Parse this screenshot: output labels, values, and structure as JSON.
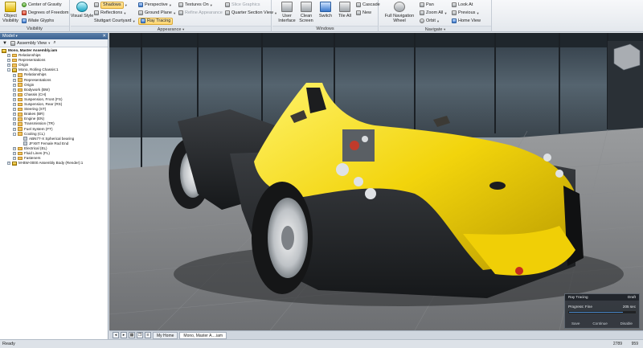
{
  "ribbon": {
    "visibility": {
      "label": "Visibility",
      "object_visibility": "Object\nVisibility",
      "center_of_gravity": "Center of Gravity",
      "degrees_of_freedom": "Degrees of Freedom",
      "imate_glyphs": "iMate Glyphs"
    },
    "appearance": {
      "label": "Appearance",
      "visual_style": "Visual Style",
      "shadows": "Shadows",
      "reflections": "Reflections",
      "stuttgart_courtyard": "Stuttgart Courtyard",
      "perspective": "Perspective",
      "ground_plane": "Ground Plane",
      "ray_tracing": "Ray Tracing",
      "textures_on": "Textures On",
      "refine_appearance": "Refine Appearance",
      "slice_graphics": "Slice Graphics",
      "quarter_section_view": "Quarter Section View"
    },
    "windows": {
      "label": "Windows",
      "user_interface": "User\nInterface",
      "clean_screen": "Clean\nScreen",
      "switch": "Switch",
      "tile_all": "Tile All",
      "cascade": "Cascade",
      "new": "New"
    },
    "navigate": {
      "label": "Navigate",
      "full_navigation_wheel": "Full Navigation\nWheel",
      "pan": "Pan",
      "zoom_all": "Zoom All",
      "orbit": "Orbit",
      "look_at": "Look At",
      "previous": "Previous",
      "home_view": "Home View"
    }
  },
  "browser": {
    "title": "Model",
    "filter_view": "Assembly View",
    "tree": [
      {
        "label": "Mono, Master Assembly.iam",
        "icon": "asm",
        "indent": 0,
        "bold": true
      },
      {
        "label": "Relationships",
        "icon": "fol",
        "indent": 1,
        "pm": "+"
      },
      {
        "label": "Representations",
        "icon": "fol",
        "indent": 1,
        "pm": "+"
      },
      {
        "label": "Origin",
        "icon": "fol",
        "indent": 1,
        "pm": "+"
      },
      {
        "label": "Mono, Rolling Chassis:1",
        "icon": "asm",
        "indent": 1,
        "pm": "-"
      },
      {
        "label": "Relationships",
        "icon": "fol",
        "indent": 2,
        "pm": "+"
      },
      {
        "label": "Representations",
        "icon": "fol",
        "indent": 2,
        "pm": "+"
      },
      {
        "label": "Origin",
        "icon": "fol",
        "indent": 2,
        "pm": "+"
      },
      {
        "label": "Bodywork (BW)",
        "icon": "fol",
        "indent": 2,
        "pm": "+"
      },
      {
        "label": "Chassis (CH)",
        "icon": "fol",
        "indent": 2,
        "pm": "+"
      },
      {
        "label": "Suspension, Front (FS)",
        "icon": "fol",
        "indent": 2,
        "pm": "+"
      },
      {
        "label": "Suspension, Rear (RS)",
        "icon": "fol",
        "indent": 2,
        "pm": "+"
      },
      {
        "label": "Steering (ST)",
        "icon": "fol",
        "indent": 2,
        "pm": "+"
      },
      {
        "label": "Brakes (BR)",
        "icon": "fol",
        "indent": 2,
        "pm": "+"
      },
      {
        "label": "Engine (EN)",
        "icon": "fol",
        "indent": 2,
        "pm": "+"
      },
      {
        "label": "Transmission (TR)",
        "icon": "fol",
        "indent": 2,
        "pm": "+"
      },
      {
        "label": "Fuel System (FT)",
        "icon": "fol",
        "indent": 2,
        "pm": "+"
      },
      {
        "label": "Cooling (CL)",
        "icon": "fol",
        "indent": 2,
        "pm": "-"
      },
      {
        "label": "ABN77-X Spherical bearing",
        "icon": "prt",
        "indent": 3
      },
      {
        "label": "JFX8T Female Rod End",
        "icon": "prt",
        "indent": 3
      },
      {
        "label": "Electrical (EL)",
        "icon": "fol",
        "indent": 2,
        "pm": "+"
      },
      {
        "label": "Fluid Lines (FL)",
        "icon": "fol",
        "indent": 2,
        "pm": "+"
      },
      {
        "label": "Fasteners",
        "icon": "fol",
        "indent": 2,
        "pm": "+"
      },
      {
        "label": "M-BW-0000 Assembly Body (Render):1",
        "icon": "asm",
        "indent": 1,
        "pm": "+"
      }
    ]
  },
  "tabs": {
    "home": "My Home",
    "document": "Mono, Master A....iam"
  },
  "status": {
    "text": "Ready",
    "num1": "2789",
    "num2": "959"
  },
  "ray_tracing_panel": {
    "title": "Ray Tracing",
    "mode": "Draft",
    "progress_label": "Progress: Fine",
    "time": "205 sec",
    "progress": 0.82,
    "save": "Save",
    "continue": "Continue",
    "disable": "Disable"
  },
  "colors": {
    "car_body": "#f2d40c",
    "ribbon_highlight": "#ffd36b",
    "panel_title": "#4a6f9c"
  }
}
